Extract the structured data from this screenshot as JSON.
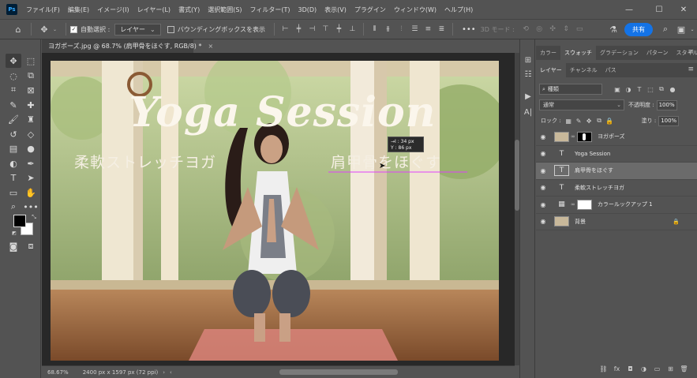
{
  "app": {
    "logo_text": "Ps",
    "menu": [
      "ファイル(F)",
      "編集(E)",
      "イメージ(I)",
      "レイヤー(L)",
      "書式(Y)",
      "選択範囲(S)",
      "フィルター(T)",
      "3D(D)",
      "表示(V)",
      "プラグイン",
      "ウィンドウ(W)",
      "ヘルプ(H)"
    ],
    "window_controls": {
      "minimize": "—",
      "maximize": "☐",
      "close": "✕"
    }
  },
  "options": {
    "auto_select_label": "自動選択 :",
    "auto_select_checked": true,
    "target_dropdown": "レイヤー",
    "bounding_box_label": "バウンディングボックスを表示",
    "more": "•••",
    "mode_3d_label": "3D モード :",
    "share_label": "共有"
  },
  "document": {
    "tab_title": "ヨガポーズ.jpg @ 68.7% (肩甲骨をほぐす, RGB/8) *",
    "tab_close": "×",
    "heading": "Yoga Session",
    "left_text": "柔軟ストレッチヨガ",
    "right_text": "肩甲骨をほぐす",
    "tooltip_lines": [
      "→I : 34 px",
      "Y : 86 px"
    ]
  },
  "status": {
    "zoom": "68.67%",
    "dimensions": "2400 px x 1597 px (72 ppi)"
  },
  "panels": {
    "top_tabs": [
      "カラー",
      "スウォッチ",
      "グラデーション",
      "パターン",
      "スタイル"
    ],
    "top_active": 1,
    "layer_tabs": [
      "レイヤー",
      "チャンネル",
      "パス"
    ],
    "layer_active": 0,
    "filter_label": "種類",
    "blend_mode": "通常",
    "opacity_label": "不透明度 :",
    "opacity_value": "100%",
    "lock_label": "ロック :",
    "fill_label": "塗り :",
    "fill_value": "100%",
    "layers": [
      {
        "name": "ヨガポーズ",
        "kind": "smart",
        "selected": false,
        "locked": false
      },
      {
        "name": "Yoga Session",
        "kind": "text",
        "selected": false,
        "locked": false
      },
      {
        "name": "肩甲骨をほぐす",
        "kind": "text-box",
        "selected": true,
        "locked": false
      },
      {
        "name": "柔軟ストレッチヨガ",
        "kind": "text",
        "selected": false,
        "locked": false
      },
      {
        "name": "カラールックアップ 1",
        "kind": "adjustment",
        "selected": false,
        "locked": false
      },
      {
        "name": "背景",
        "kind": "image",
        "selected": false,
        "locked": true
      }
    ]
  },
  "colors": {
    "accent": "#1473e6",
    "chrome": "#535353",
    "canvas_bg": "#282828",
    "guide": "#e040fb"
  }
}
